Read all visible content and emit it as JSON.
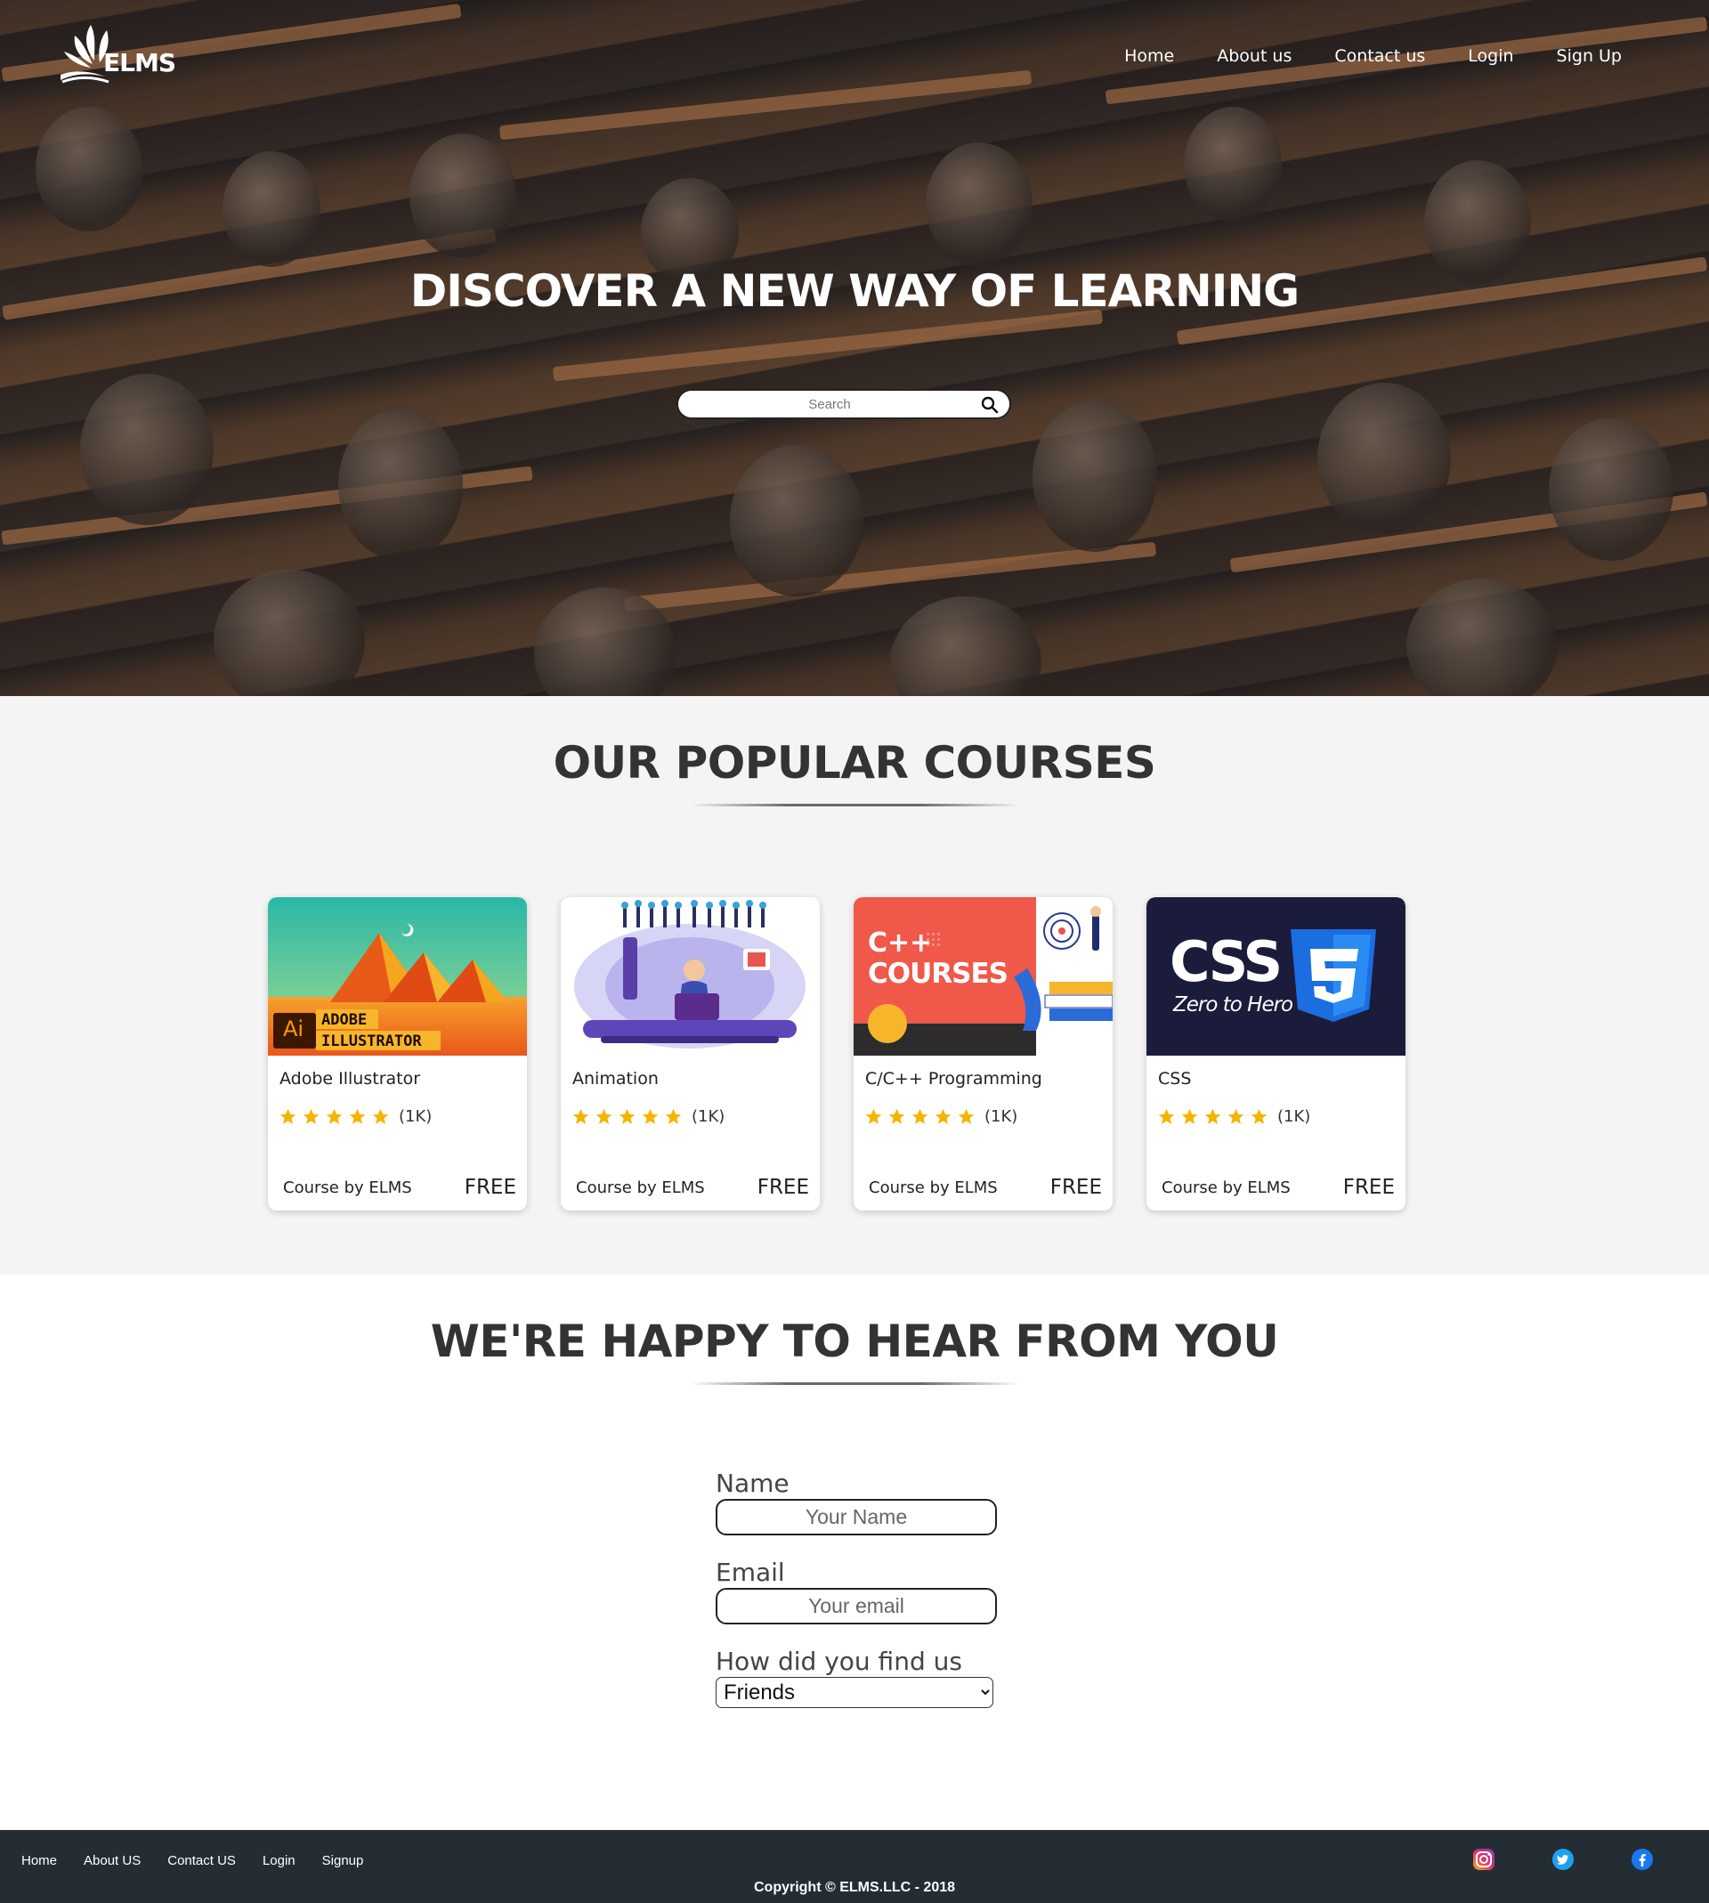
{
  "header": {
    "logo_text": "ELMS",
    "nav": [
      "Home",
      "About us",
      "Contact us",
      "Login",
      "Sign Up"
    ]
  },
  "hero": {
    "title": "DISCOVER A NEW WAY OF LEARNING",
    "search_placeholder": "Search"
  },
  "courses": {
    "title": "OUR POPULAR COURSES",
    "items": [
      {
        "title": "Adobe Illustrator",
        "rating": "(1K)",
        "stars": 5,
        "by": "Course by ELMS",
        "price": "FREE",
        "thumb_text": [
          "Ai",
          "ADOBE",
          "ILLUSTRATOR"
        ]
      },
      {
        "title": "Animation",
        "rating": "(1K)",
        "stars": 5,
        "by": "Course by ELMS",
        "price": "FREE",
        "thumb_text": []
      },
      {
        "title": "C/C++ Programming",
        "rating": "(1K)",
        "stars": 5,
        "by": "Course by ELMS",
        "price": "FREE",
        "thumb_text": [
          "C++",
          "COURSES"
        ]
      },
      {
        "title": "CSS",
        "rating": "(1K)",
        "stars": 5,
        "by": "Course by ELMS",
        "price": "FREE",
        "thumb_text": [
          "CSS",
          "Zero to Hero"
        ]
      }
    ]
  },
  "contact": {
    "title": "WE'RE HAPPY TO HEAR FROM YOU",
    "name_label": "Name",
    "name_placeholder": "Your Name",
    "email_label": "Email",
    "email_placeholder": "Your email",
    "source_label": "How did you find us",
    "source_selected": "Friends"
  },
  "footer": {
    "nav": [
      "Home",
      "About US",
      "Contact US",
      "Login",
      "Signup"
    ],
    "copyright": "Copyright © ELMS.LLC - 2018",
    "social_icons": [
      "instagram-icon",
      "twitter-icon",
      "facebook-icon"
    ]
  },
  "colors": {
    "footer_bg": "#252d34",
    "section_bg": "#f4f4f4",
    "star": "#f5b400"
  }
}
